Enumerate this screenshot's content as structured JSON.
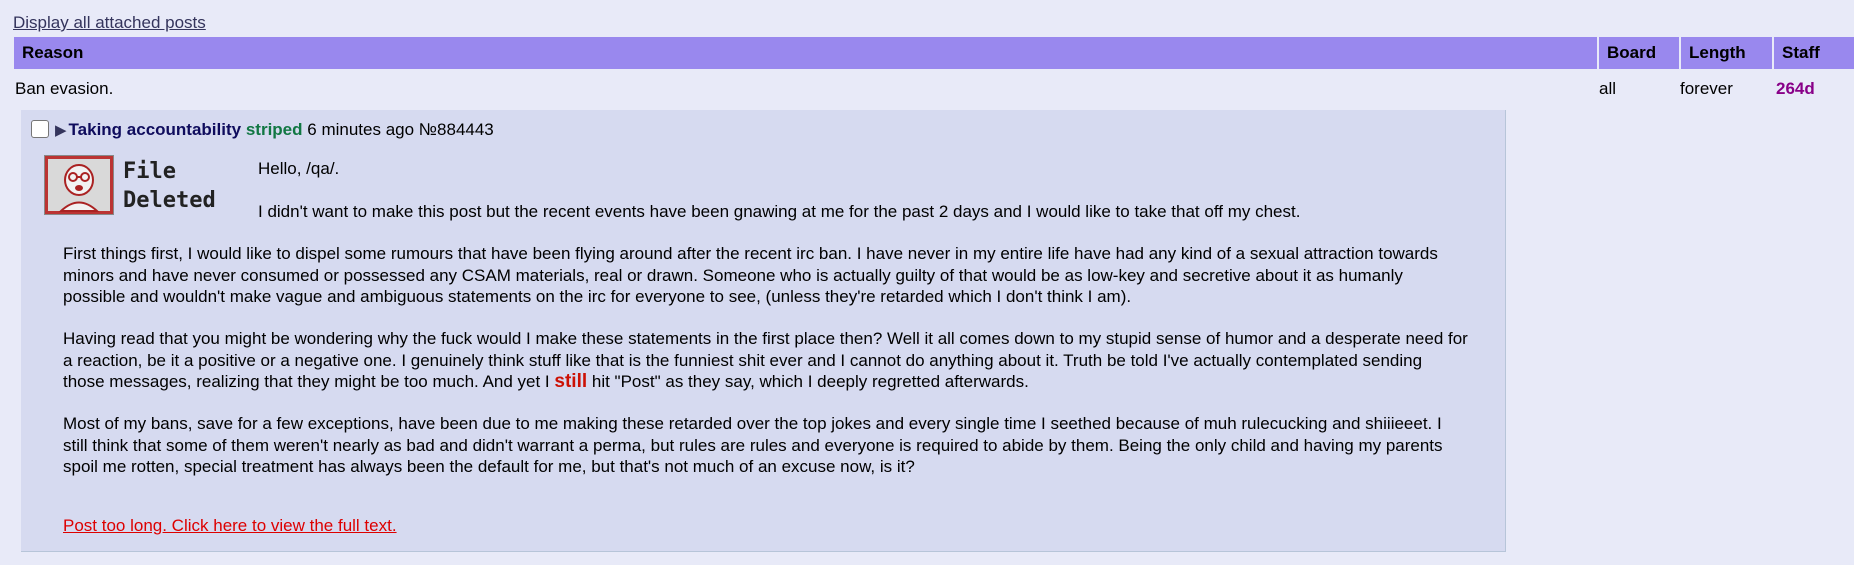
{
  "display_link": "Display all attached posts",
  "table": {
    "headers": {
      "reason": "Reason",
      "board": "Board",
      "length": "Length",
      "staff": "Staff"
    },
    "row": {
      "reason": "Ban evasion.",
      "board": "all",
      "length": "forever",
      "staff": "264d"
    }
  },
  "post": {
    "subject": "Taking accountability",
    "name": "striped",
    "time": "6 minutes ago",
    "number": "№884443",
    "file_deleted": "File\nDeleted",
    "greeting": "Hello, /qa/.",
    "p1": "I didn't want to make this post but the recent events have been gnawing at me for the past 2 days and I would like to take that off my chest.",
    "p2": "First things first, I would like to dispel some rumours that have been flying around after the recent irc ban. I have never in my entire life have had any kind of a sexual attraction towards minors and have never consumed or possessed any CSAM materials, real or drawn. Someone who is actually guilty of that would be as low-key and secretive about it as humanly possible and wouldn't make vague and ambiguous statements on the irc for everyone to see, (unless they're retarded which I don't think I am).",
    "p3_before": "Having read that you might be wondering why the fuck would I make these statements in the first place then? Well it all comes down to my stupid sense of humor and a desperate need for a reaction, be it a positive or a negative one. I genuinely think stuff like that is the funniest shit ever and I cannot do anything about it. Truth be told I've actually contemplated sending those messages, realizing that they might be too much. And yet I",
    "p3_emph": "still",
    "p3_after": "hit \"Post\" as they say, which I deeply regretted afterwards.",
    "p4": "Most of my bans, save for a few exceptions, have been due to me making these retarded over the top jokes and every single time I seethed because of muh rulecucking and shiiieeet. I still think that some of them weren't nearly as bad and didn't warrant a perma, but rules are rules and everyone is required to abide by them. Being the only child and having my parents spoil me rotten, special treatment has always been the default for me, but that's not much of an excuse now, is it?",
    "too_long": "Post too long. Click here to view the full text."
  },
  "icons": {
    "expand": "triangle-right-icon",
    "thumbnail": "file-deleted-thumbnail"
  },
  "colors": {
    "background": "#e8eaf8",
    "header": "#9988ee",
    "post_bg": "#d6daf0",
    "subject": "#0f0c5d",
    "name": "#117743",
    "staff": "#880088",
    "emphasis": "#cc1105",
    "link_red": "#dd0000"
  }
}
